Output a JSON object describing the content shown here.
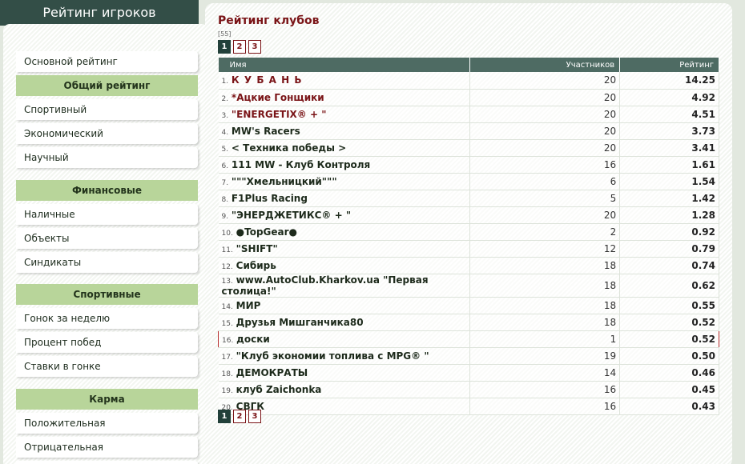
{
  "sidebar": {
    "header": "Рейтинг игроков",
    "top_item": "Основной рейтинг",
    "groups": [
      {
        "title": "Общий рейтинг",
        "items": [
          "Спортивный",
          "Экономический",
          "Научный"
        ]
      },
      {
        "title": "Финансовые",
        "items": [
          "Наличные",
          "Объекты",
          "Синдикаты"
        ]
      },
      {
        "title": "Спортивные",
        "items": [
          "Гонок за неделю",
          "Процент побед",
          "Ставки в гонке"
        ]
      },
      {
        "title": "Карма",
        "items": [
          "Положительная",
          "Отрицательная"
        ]
      }
    ]
  },
  "main": {
    "title": "Рейтинг клубов",
    "total": "[55]",
    "pages": [
      "1",
      "2",
      "3"
    ],
    "active_page": "1",
    "columns": {
      "name": "Имя",
      "members": "Участников",
      "rating": "Рейтинг"
    },
    "rows": [
      {
        "num": "1.",
        "name": "К У Б А Н Ь",
        "members": "20",
        "rating": "14.25"
      },
      {
        "num": "2.",
        "name": "*Ацкие Гонщики",
        "members": "20",
        "rating": "4.92"
      },
      {
        "num": "3.",
        "name": "\"ENERGETIX® + \"",
        "members": "20",
        "rating": "4.51"
      },
      {
        "num": "4.",
        "name": "MW's Racers",
        "members": "20",
        "rating": "3.73"
      },
      {
        "num": "5.",
        "name": "< Техника победы >",
        "members": "20",
        "rating": "3.41"
      },
      {
        "num": "6.",
        "name": "111 MW - Клуб Контроля",
        "members": "16",
        "rating": "1.61"
      },
      {
        "num": "7.",
        "name": "\"\"\"Хмельницкий\"\"\"",
        "members": "6",
        "rating": "1.54"
      },
      {
        "num": "8.",
        "name": "F1Plus Racing",
        "members": "5",
        "rating": "1.42"
      },
      {
        "num": "9.",
        "name": "\"ЭНЕРДЖЕТИКС® + \"",
        "members": "20",
        "rating": "1.28"
      },
      {
        "num": "10.",
        "name": "●TopGear●",
        "members": "2",
        "rating": "0.92"
      },
      {
        "num": "11.",
        "name": "\"SHIFT\"",
        "members": "12",
        "rating": "0.79"
      },
      {
        "num": "12.",
        "name": "Сибирь",
        "members": "18",
        "rating": "0.74"
      },
      {
        "num": "13.",
        "name": "www.AutoClub.Kharkov.ua \"Первая столица!\"",
        "members": "18",
        "rating": "0.62"
      },
      {
        "num": "14.",
        "name": "МИР",
        "members": "18",
        "rating": "0.55"
      },
      {
        "num": "15.",
        "name": "Друзья Мишганчика80",
        "members": "18",
        "rating": "0.52"
      },
      {
        "num": "16.",
        "name": "доски",
        "members": "1",
        "rating": "0.52"
      },
      {
        "num": "17.",
        "name": "\"Клуб экономии топлива с MPG® \"",
        "members": "19",
        "rating": "0.50"
      },
      {
        "num": "18.",
        "name": "ДЕМОКРАТЫ",
        "members": "14",
        "rating": "0.46"
      },
      {
        "num": "19.",
        "name": "клуб Zaichonka",
        "members": "16",
        "rating": "0.45"
      },
      {
        "num": "20.",
        "name": "СВГК",
        "members": "16",
        "rating": "0.43"
      }
    ]
  },
  "colors": {
    "header_bg": "#334e47",
    "menu_head_bg": "#b8d59a",
    "table_head_bg": "#4e6b63",
    "accent_red": "#7a1417",
    "highlight_border": "#b72d2d"
  }
}
